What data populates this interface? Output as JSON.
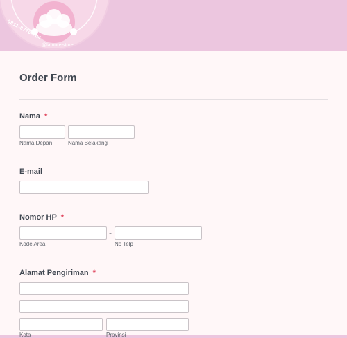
{
  "header": {
    "logo_phone": "0811-9770-704",
    "logo_handle": "@lamoreistore"
  },
  "form": {
    "title": "Order Form",
    "required_marker": "*",
    "nama": {
      "label": "Nama",
      "first_sublabel": "Nama Depan",
      "last_sublabel": "Nama Belakang",
      "first_value": "",
      "last_value": ""
    },
    "email": {
      "label": "E-mail",
      "value": ""
    },
    "phone": {
      "label": "Nomor HP",
      "separator": "-",
      "area_sublabel": "Kode Area",
      "number_sublabel": "No Telp",
      "area_value": "",
      "number_value": ""
    },
    "address": {
      "label": "Alamat Pengiriman",
      "line1_value": "",
      "line2_value": "",
      "city_sublabel": "Kota",
      "province_sublabel": "Provinsi",
      "city_value": "",
      "province_value": ""
    }
  },
  "colors": {
    "header_bg": "#ecc6df",
    "card_bg": "#fff7f8",
    "required": "#e0465e",
    "text": "#3f4650"
  }
}
